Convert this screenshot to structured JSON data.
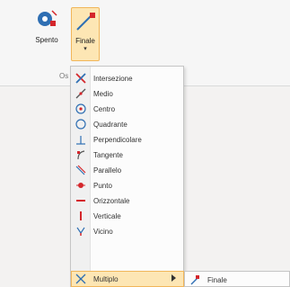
{
  "ribbon": {
    "spento_label": "Spento",
    "finale_label": "Finale",
    "group_label": "Os"
  },
  "menu": {
    "items": [
      {
        "label": "Intersezione"
      },
      {
        "label": "Medio"
      },
      {
        "label": "Centro"
      },
      {
        "label": "Quadrante"
      },
      {
        "label": "Perpendicolare"
      },
      {
        "label": "Tangente"
      },
      {
        "label": "Parallelo"
      },
      {
        "label": "Punto"
      },
      {
        "label": "Orizzontale"
      },
      {
        "label": "Verticale"
      },
      {
        "label": "Vicino"
      },
      {
        "label": "Multiplo"
      }
    ]
  },
  "submenu": {
    "items": [
      {
        "label": "Finale"
      }
    ]
  },
  "colors": {
    "highlight": "#fde6b4",
    "highlight_border": "#f1b65a",
    "accent_red": "#d4262b",
    "accent_blue": "#2f6fb3"
  },
  "icons": {
    "spento": "object-snap-off-icon",
    "finale": "endpoint-snap-icon",
    "intersezione": "intersection-icon",
    "medio": "midpoint-icon",
    "centro": "center-icon",
    "quadrante": "quadrant-icon",
    "perpendicolare": "perpendicular-icon",
    "tangente": "tangent-icon",
    "parallelo": "parallel-icon",
    "punto": "point-icon",
    "orizzontale": "horizontal-icon",
    "verticale": "vertical-icon",
    "vicino": "nearest-icon",
    "multiplo": "multiple-icon"
  }
}
